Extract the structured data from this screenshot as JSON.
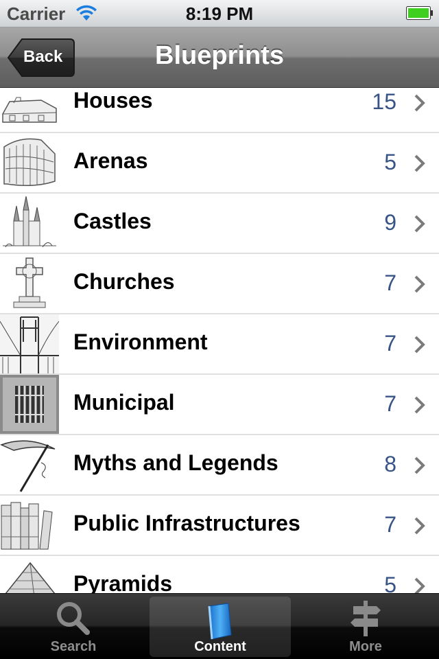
{
  "status_bar": {
    "carrier": "Carrier",
    "time": "8:19 PM",
    "wifi_icon": "wifi-icon",
    "battery_icon": "battery-icon"
  },
  "nav_bar": {
    "back_label": "Back",
    "title": "Blueprints"
  },
  "list": {
    "rows": [
      {
        "label": "Houses",
        "count": "15",
        "thumb_icon": "house-sketch-icon"
      },
      {
        "label": "Arenas",
        "count": "5",
        "thumb_icon": "colosseum-sketch-icon"
      },
      {
        "label": "Castles",
        "count": "9",
        "thumb_icon": "castle-sketch-icon"
      },
      {
        "label": "Churches",
        "count": "7",
        "thumb_icon": "cross-sketch-icon"
      },
      {
        "label": "Environment",
        "count": "7",
        "thumb_icon": "bridge-sketch-icon"
      },
      {
        "label": "Municipal",
        "count": "7",
        "thumb_icon": "prison-window-sketch-icon"
      },
      {
        "label": "Myths and Legends",
        "count": "8",
        "thumb_icon": "scythe-sketch-icon"
      },
      {
        "label": "Public Infrastructures",
        "count": "7",
        "thumb_icon": "books-sketch-icon"
      },
      {
        "label": "Pyramids",
        "count": "5",
        "thumb_icon": "pyramid-sketch-icon"
      }
    ]
  },
  "tab_bar": {
    "tabs": [
      {
        "label": "Search",
        "icon": "magnifier-icon",
        "active": false
      },
      {
        "label": "Content",
        "icon": "book-icon",
        "active": true
      },
      {
        "label": "More",
        "icon": "signpost-icon",
        "active": false
      }
    ]
  },
  "colors": {
    "count_text": "#385487",
    "nav_bar": "#8e8e8e",
    "battery_fill": "#3fcf1e"
  }
}
